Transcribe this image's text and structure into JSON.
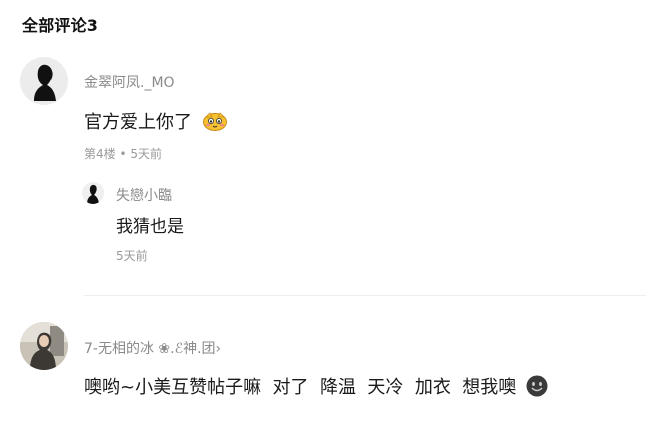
{
  "header": {
    "title": "全部评论3"
  },
  "comments": [
    {
      "username": "金翠阿凤._MO",
      "content": "官方爱上你了",
      "emoji": "shy-face-emoji",
      "meta": "第4楼 • 5天前",
      "replies": [
        {
          "username": "失戀小臨",
          "content": "我猜也是",
          "meta": "5天前"
        }
      ]
    },
    {
      "username": "7-无相的冰 ❀.ℰ神.团›",
      "content": "噢哟~小美互赞帖子嘛  对了  降温  天冷  加衣  想我噢",
      "emoji": "grin-face-emoji"
    }
  ]
}
